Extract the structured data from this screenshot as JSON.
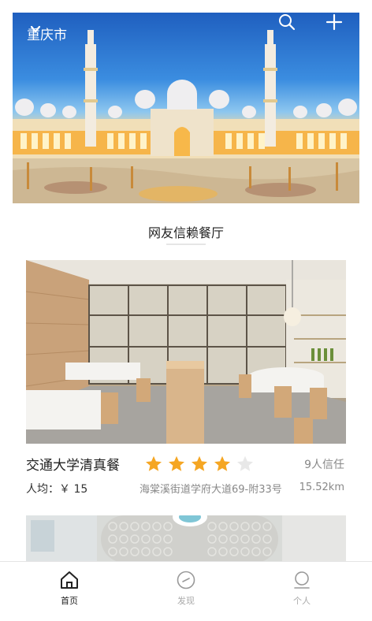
{
  "header": {
    "city": "重庆市",
    "city_chevron_icon": "chevron-down-icon",
    "search_icon": "search-icon",
    "add_icon": "plus-icon"
  },
  "section": {
    "title": "网友信赖餐厅"
  },
  "restaurants": [
    {
      "name": "交通大学清真餐",
      "rating": 4,
      "rating_max": 5,
      "trust": "9人信任",
      "avg_price": "人均：￥ 15",
      "address": "海棠溪街道学府大道69-附33号",
      "distance": "15.52km"
    }
  ],
  "colors": {
    "star_active": "#f5a623",
    "star_inactive": "#e8e8e8",
    "tab_active": "#222222",
    "tab_inactive": "#aaaaaa"
  },
  "tabbar": {
    "tabs": [
      {
        "label": "首页",
        "icon": "home-icon",
        "active": true
      },
      {
        "label": "发现",
        "icon": "compass-icon",
        "active": false
      },
      {
        "label": "个人",
        "icon": "user-icon",
        "active": false
      }
    ]
  }
}
